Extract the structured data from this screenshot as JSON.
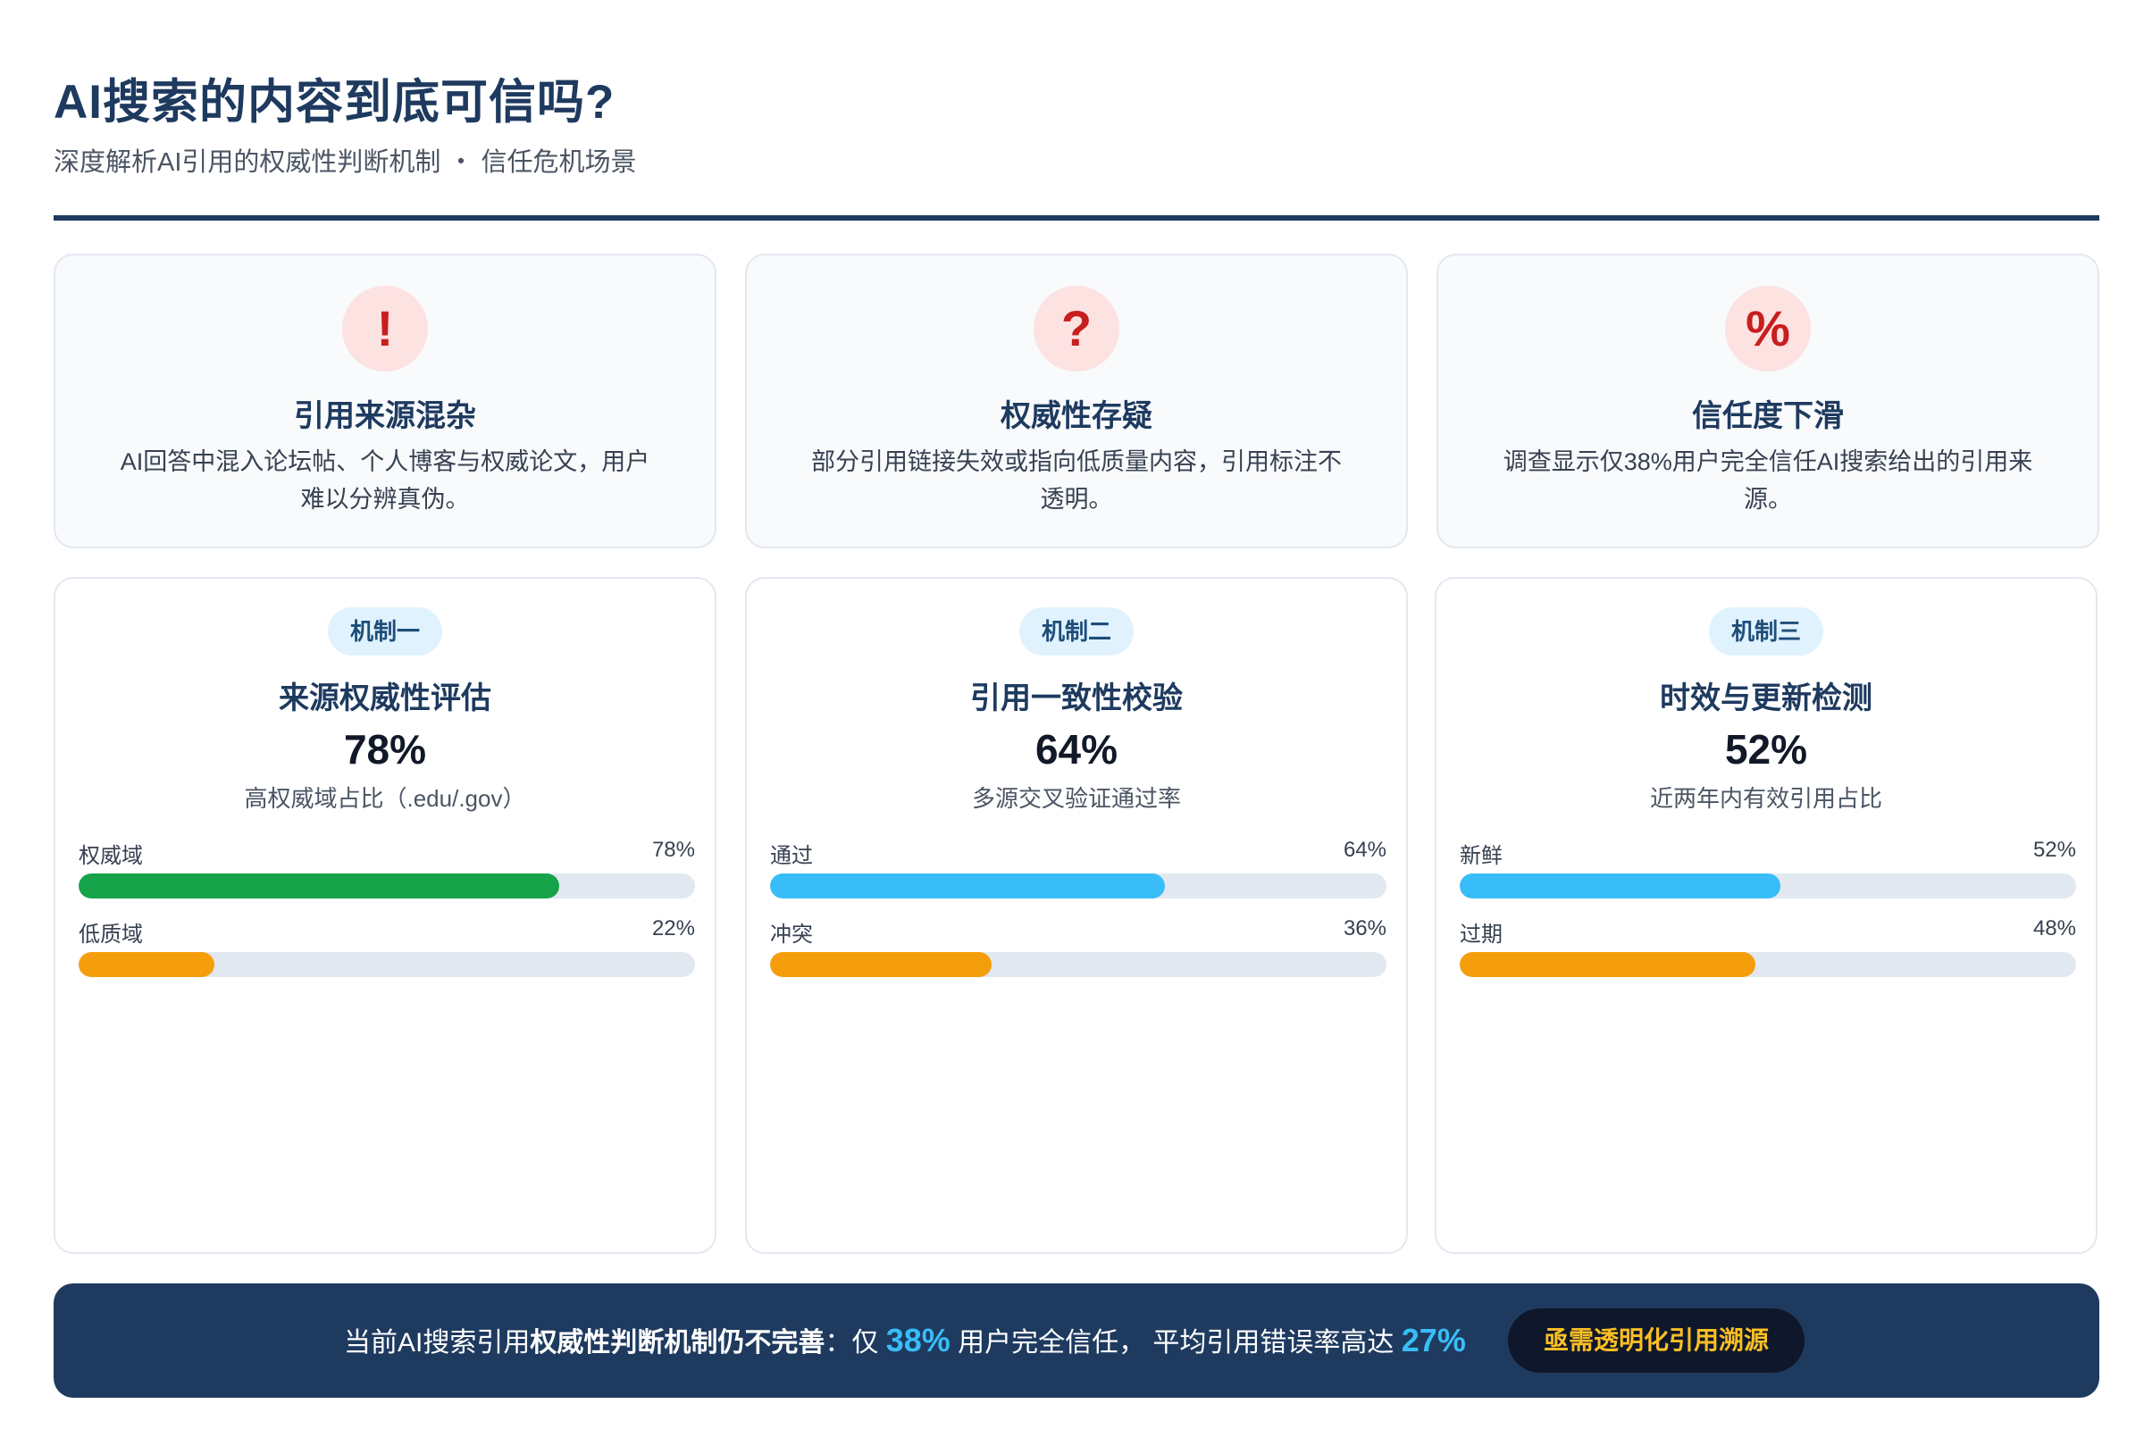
{
  "header": {
    "title": "AI搜索的内容到底可信吗?",
    "subtitle": "深度解析AI引用的权威性判断机制 ・ 信任危机场景"
  },
  "issues": [
    {
      "icon": "!",
      "icon_name": "exclamation-icon",
      "title": "引用来源混杂",
      "desc": "AI回答中混入论坛帖、个人博客与权威论文，用户难以分辨真伪。"
    },
    {
      "icon": "?",
      "icon_name": "question-icon",
      "title": "权威性存疑",
      "desc": "部分引用链接失效或指向低质量内容，引用标注不透明。"
    },
    {
      "icon": "%",
      "icon_name": "percent-icon",
      "title": "信任度下滑",
      "desc": "调查显示仅38%用户完全信任AI搜索给出的引用来源。"
    }
  ],
  "mechanisms": [
    {
      "badge": "机制一",
      "title": "来源权威性评估",
      "value": "78%",
      "desc": "高权威域占比（.edu/.gov）",
      "bars": [
        {
          "label": "权威域",
          "pct_text": "78%",
          "pct": 78,
          "color": "#16a34a"
        },
        {
          "label": "低质域",
          "pct_text": "22%",
          "pct": 22,
          "color": "#f59e0b"
        }
      ]
    },
    {
      "badge": "机制二",
      "title": "引用一致性校验",
      "value": "64%",
      "desc": "多源交叉验证通过率",
      "bars": [
        {
          "label": "通过",
          "pct_text": "64%",
          "pct": 64,
          "color": "#38bdf8"
        },
        {
          "label": "冲突",
          "pct_text": "36%",
          "pct": 36,
          "color": "#f59e0b"
        }
      ]
    },
    {
      "badge": "机制三",
      "title": "时效与更新检测",
      "value": "52%",
      "desc": "近两年内有效引用占比",
      "bars": [
        {
          "label": "新鲜",
          "pct_text": "52%",
          "pct": 52,
          "color": "#38bdf8"
        },
        {
          "label": "过期",
          "pct_text": "48%",
          "pct": 48,
          "color": "#f59e0b"
        }
      ]
    }
  ],
  "summary": {
    "prefix": "当前AI搜索引用",
    "bold": "权威性判断机制仍不完善",
    "mid1": "：仅 ",
    "stat1": "38%",
    "mid2": " 用户完全信任， 平均引用错误率高达 ",
    "stat2": "27%",
    "button": "亟需透明化引用溯源"
  }
}
